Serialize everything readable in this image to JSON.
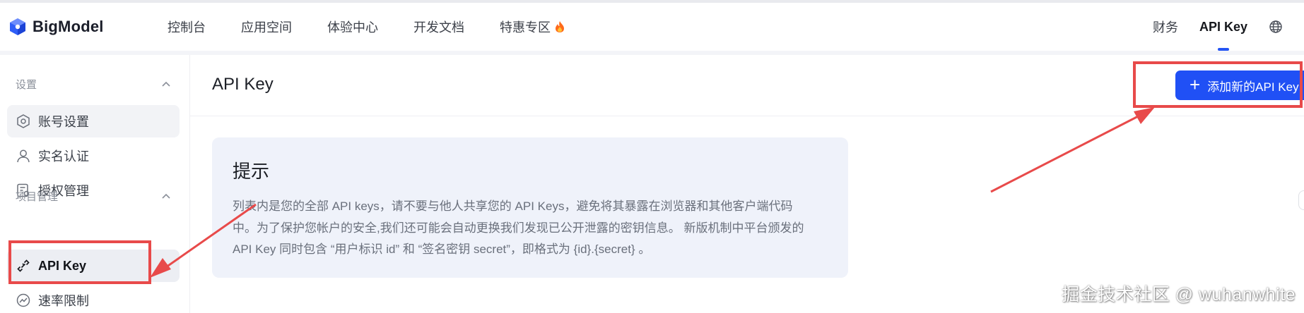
{
  "brand": {
    "name": "BigModel",
    "color": "#2455f4"
  },
  "nav": {
    "items": [
      "控制台",
      "应用空间",
      "体验中心",
      "开发文档",
      "特惠专区"
    ],
    "right": {
      "finance": "财务",
      "api_key": "API Key"
    }
  },
  "sidebar": {
    "settings_header": "设置",
    "settings_items": [
      "账号设置",
      "实名认证",
      "授权管理"
    ],
    "project_header": "项目管理",
    "project_items": [
      "API Key",
      "速率限制"
    ]
  },
  "main": {
    "title": "API Key",
    "add_button": "添加新的API Key",
    "tip": {
      "title": "提示",
      "line1": "列表内是您的全部 API keys，请不要与他人共享您的 API Keys，避免将其暴露在浏览器和其他客户端代码",
      "line2": "中。为了保护您帐户的安全,我们还可能会自动更换我们发现已公开泄露的密钥信息。 新版机制中平台颁发的",
      "line3": "API Key 同时包含 “用户标识 id” 和 “签名密钥 secret”，即格式为 {id}.{secret} 。"
    }
  },
  "annotation": {
    "color": "#e84a4a"
  },
  "watermark": "掘金技术社区 @ wuhanwhite"
}
